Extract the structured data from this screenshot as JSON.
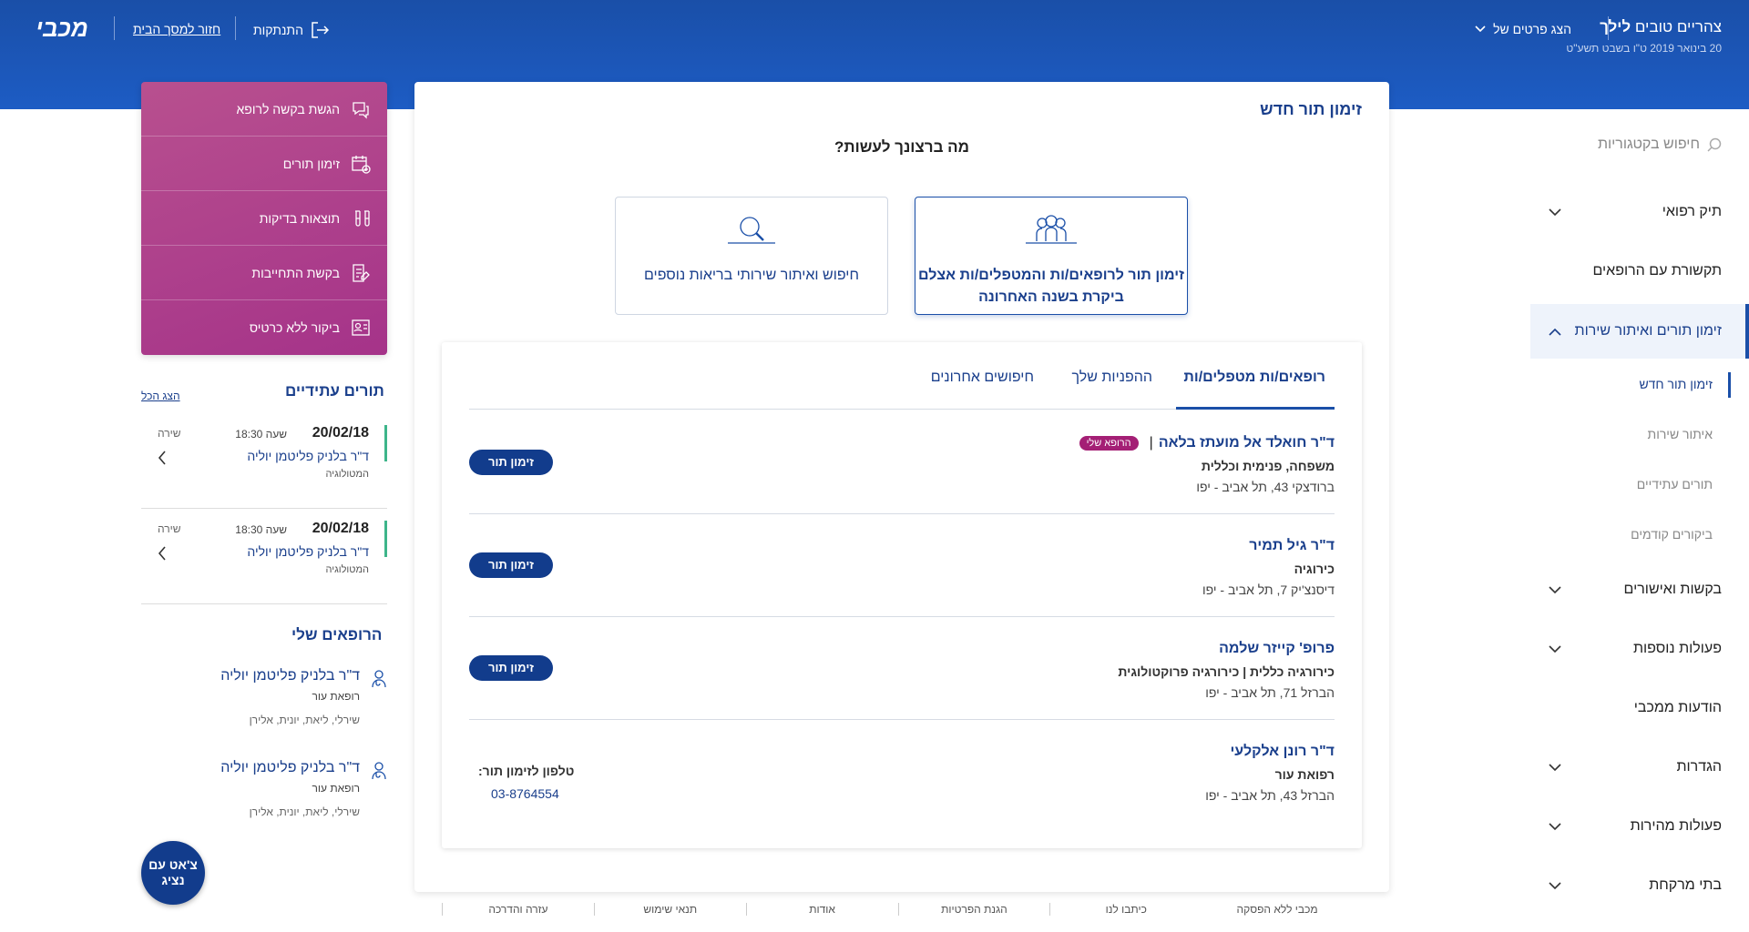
{
  "header": {
    "greeting_prefix": "צהריים טובים",
    "user_name": "לילך",
    "date": "20 בינואר 2019 ט\"ו בשבט תשע\"ט",
    "show_details": "הצג פרטים של",
    "logout": "התנתקות",
    "back_home": "חזור למסך הבית",
    "logo": "מכבי"
  },
  "sidebar": {
    "search": "חיפוש בקטגוריות",
    "items": [
      {
        "label": "תיק רפואי"
      },
      {
        "label": "תקשורת עם הרופאים"
      },
      {
        "label": "זימון תורים ואיתור שירות"
      },
      {
        "label": "בקשות ואישורים"
      },
      {
        "label": "פעולות נוספות"
      },
      {
        "label": "הודעות ממכבי"
      },
      {
        "label": "הגדרות"
      },
      {
        "label": "פעולות מהירות"
      },
      {
        "label": "בתי מרקחת"
      }
    ],
    "subitems": [
      {
        "label": "זימון תור חדש"
      },
      {
        "label": "איתור שירות"
      },
      {
        "label": "תורים עתידיים"
      },
      {
        "label": "ביקורים קודמים"
      }
    ]
  },
  "main": {
    "title": "זימון תור חדש",
    "question": "מה ברצונך לעשות?",
    "option_primary": "זימון תור לרופאים/ות והמטפלים/ות אצלם ביקרת בשנה האחרונה",
    "option_secondary": "חיפוש ואיתור שירותי בריאות נוספים",
    "tabs": [
      {
        "label": "רופאים/ות מטפלים/ות"
      },
      {
        "label": "ההפניות שלך"
      },
      {
        "label": "חיפושים אחרונים"
      }
    ],
    "doctors": [
      {
        "name": "ד\"ר חואלד אל מועתז בלאה",
        "badge": "הרופא שלי",
        "specialty": "משפחה, פנימית וכללית",
        "address": "ברודצקי 43, תל אביב - יפו",
        "button": "זימון תור"
      },
      {
        "name": "ד\"ר גיל תמיר",
        "specialty": "כירוגיה",
        "address": "דיסנצ'יק 7, תל אביב - יפו",
        "button": "זימון תור"
      },
      {
        "name": "פרופ' קייזר שלמה",
        "specialty": "כירורגיה כללית  |  כירורגיה פרוקטולוגית",
        "address": "הברזל 71, תל אביב - יפו",
        "button": "זימון תור"
      },
      {
        "name": "ד\"ר רונן אלקלעי",
        "specialty": "רפואת עור",
        "address": "הברזל 43, תל אביב - יפו",
        "phone_label": "טלפון לזימון תור:",
        "phone": "03-8764554"
      }
    ]
  },
  "footer": {
    "links": [
      "עזרה והדרכה",
      "תנאי שימוש",
      "אודות",
      "הגנת הפרטיות",
      "כיתבו לנו",
      "מכבי ללא הפסקה"
    ]
  },
  "quick_actions": [
    {
      "label": "הגשת בקשה לרופא"
    },
    {
      "label": "זימון תורים"
    },
    {
      "label": "תוצאות בדיקות"
    },
    {
      "label": "בקשת התחייבות"
    },
    {
      "label": "ביקור ללא כרטיס"
    }
  ],
  "upcoming": {
    "title": "תורים עתידיים",
    "show_all": "הצג הכל",
    "items": [
      {
        "date": "20/02/18",
        "time": "שעה 18:30",
        "service": "שירה",
        "doctor": "ד\"ר בלניק פליטמן יוליה",
        "specialty": "המטולוגיה"
      },
      {
        "date": "20/02/18",
        "time": "שעה 18:30",
        "service": "שירה",
        "doctor": "ד\"ר בלניק פליטמן יוליה",
        "specialty": "המטולוגיה"
      }
    ]
  },
  "my_doctors": {
    "title": "הרופאים שלי",
    "items": [
      {
        "name": "ד\"ר בלניק פליטמן יוליה",
        "role": "רופאת עור",
        "patients": "שירלי, ליאת, יונית, אלירן"
      },
      {
        "name": "ד\"ר בלניק פליטמן יוליה",
        "role": "רופאת עור",
        "patients": "שירלי, ליאת, יונית, אלירן"
      }
    ]
  },
  "chat": {
    "label": "צ'אט עם נציג"
  },
  "colors": {
    "brand_blue": "#1a4fa8",
    "accent_magenta": "#a53389",
    "status_green": "#3db58a"
  }
}
